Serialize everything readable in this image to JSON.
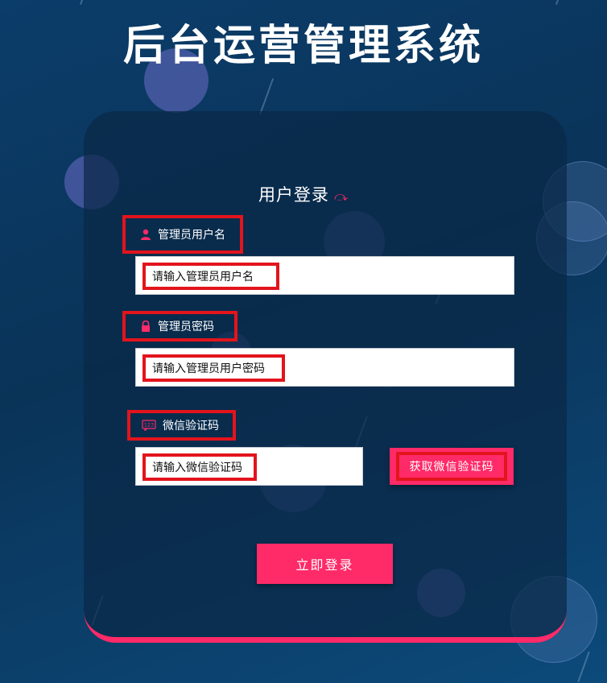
{
  "page": {
    "title": "后台运营管理系统"
  },
  "login_card": {
    "title": "用户登录",
    "username": {
      "label": "管理员用户名",
      "placeholder": "请输入管理员用户名",
      "icon": "user-icon"
    },
    "password": {
      "label": "管理员密码",
      "placeholder": "请输入管理员用户密码",
      "icon": "lock-icon"
    },
    "wechat_code": {
      "label": "微信验证码",
      "placeholder": "请输入微信验证码",
      "icon": "code-123-icon"
    },
    "get_code_button": "获取微信验证码",
    "login_button": "立即登录"
  },
  "colors": {
    "accent": "#ff2a68",
    "background": "#0a3358",
    "highlight_box": "#e3141c"
  }
}
